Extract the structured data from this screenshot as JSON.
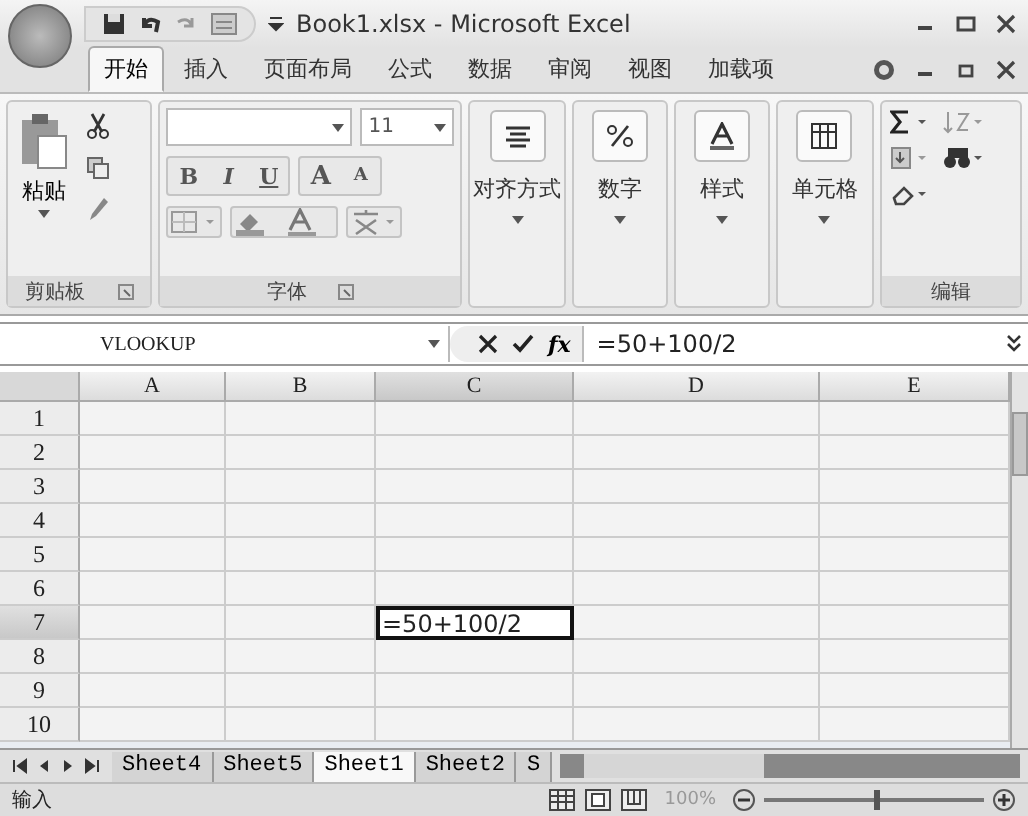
{
  "window": {
    "title": "Book1.xlsx - Microsoft Excel"
  },
  "tabs": [
    {
      "label": "开始",
      "selected": true
    },
    {
      "label": "插入",
      "selected": false
    },
    {
      "label": "页面布局",
      "selected": false
    },
    {
      "label": "公式",
      "selected": false
    },
    {
      "label": "数据",
      "selected": false
    },
    {
      "label": "审阅",
      "selected": false
    },
    {
      "label": "视图",
      "selected": false
    },
    {
      "label": "加载项",
      "selected": false
    }
  ],
  "ribbon": {
    "clipboard": {
      "paste": "粘贴",
      "title": "剪贴板"
    },
    "font": {
      "size": "11",
      "bold": "B",
      "italic": "I",
      "underline": "U",
      "grow": "A",
      "shrink": "A",
      "title": "字体"
    },
    "groups": [
      {
        "label": "对齐方式",
        "kind": "align"
      },
      {
        "label": "数字",
        "kind": "percent"
      },
      {
        "label": "样式",
        "kind": "style"
      },
      {
        "label": "单元格",
        "kind": "cells"
      }
    ],
    "editing": {
      "title": "编辑"
    }
  },
  "formula_bar": {
    "name_box": "VLOOKUP",
    "fx": "fx",
    "value": "=50+100/2"
  },
  "columns": [
    {
      "label": "A",
      "selected": false
    },
    {
      "label": "B",
      "selected": false
    },
    {
      "label": "C",
      "selected": true
    },
    {
      "label": "D",
      "selected": false
    },
    {
      "label": "E",
      "selected": false
    }
  ],
  "rows": [
    {
      "label": "1",
      "selected": false
    },
    {
      "label": "2",
      "selected": false
    },
    {
      "label": "3",
      "selected": false
    },
    {
      "label": "4",
      "selected": false
    },
    {
      "label": "5",
      "selected": false
    },
    {
      "label": "6",
      "selected": false
    },
    {
      "label": "7",
      "selected": true,
      "cells": [
        {
          "selected": false
        },
        {
          "selected": false
        },
        {
          "selected": true,
          "value": "=50+100/2"
        },
        {
          "selected": false
        },
        {
          "selected": false
        }
      ]
    },
    {
      "label": "8",
      "selected": false
    },
    {
      "label": "9",
      "selected": false
    },
    {
      "label": "10",
      "selected": false
    }
  ],
  "sheet_tabs": [
    {
      "label": "Sheet4",
      "selected": false
    },
    {
      "label": "Sheet5",
      "selected": false
    },
    {
      "label": "Sheet1",
      "selected": true
    },
    {
      "label": "Sheet2",
      "selected": false
    },
    {
      "label": "S",
      "selected": false
    }
  ],
  "status_bar": {
    "mode": "输入",
    "zoom": "100%",
    "zoom_slider": {
      "level": 0.5
    }
  }
}
